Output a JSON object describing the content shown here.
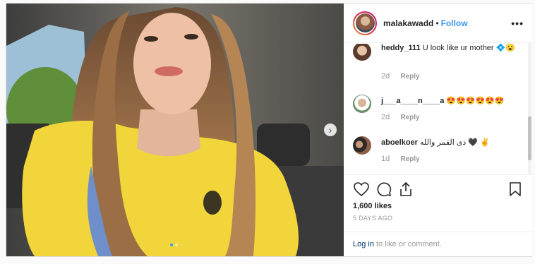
{
  "post": {
    "username": "malakawadd",
    "dot_separator": "•",
    "follow_label": "Follow",
    "more_label": "•••"
  },
  "comments": [
    {
      "user": "heddy_111",
      "text": "U look like ur mother 💠😮",
      "age": "2d",
      "reply": "Reply"
    },
    {
      "user": "j___a____n____a",
      "text": "😍😍😍😍😍😍",
      "age": "2d",
      "reply": "Reply"
    },
    {
      "user": "aboelkoer",
      "text": "ذى القمر والله 🖤 ✌",
      "age": "1d",
      "reply": "Reply"
    }
  ],
  "stats": {
    "likes": "1,600 likes",
    "date": "5 DAYS AGO"
  },
  "footer": {
    "login_label": "Log in",
    "suffix": "to like or comment."
  },
  "colors": {
    "accent": "#3897f0",
    "link": "#003569",
    "shirt": "#f2d53a"
  },
  "icons": [
    "heart-icon",
    "comment-icon",
    "share-icon",
    "bookmark-icon",
    "chevron-right-icon"
  ]
}
